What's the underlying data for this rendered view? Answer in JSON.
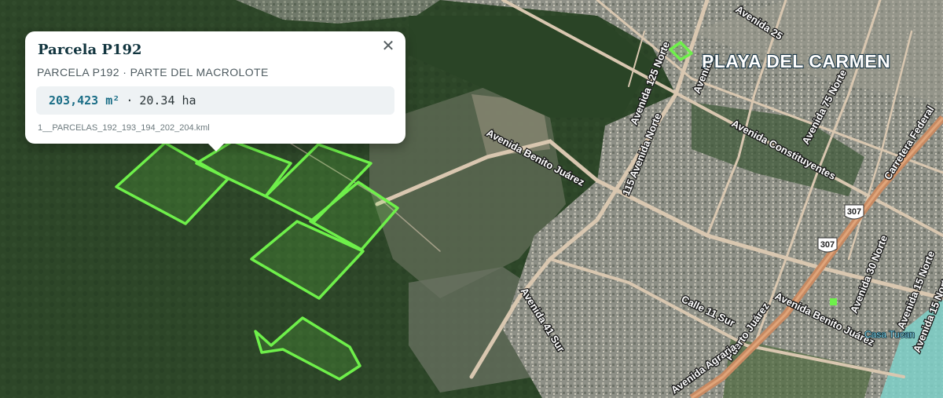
{
  "map": {
    "city_label": "PLAYA DEL CARMEN",
    "poi_label": "Casa Tucan",
    "highway_shields": [
      "307",
      "307"
    ],
    "road_labels": {
      "av_25": "Avenida 25",
      "av_norte": "Avenida",
      "av_125_norte": "Avenida 125 Norte",
      "av_115_norte": "115 Avenida Norte",
      "av_75_norte": "Avenida 75 Norte",
      "av_constituyentes": "Avenida Constituyentes",
      "av_benito_juarez_w": "Avenida Benito Juárez",
      "av_benito_juarez_e": "Avenida Benito Juárez",
      "av_41_sur": "Avenida 41 Sur",
      "calle_11_sur": "Calle 11 Sur",
      "av_puerto_juarez": "Puerto Juárez",
      "av_agraria": "Avenida Agraria",
      "av_30_norte": "Avenida 30 Norte",
      "av_15_norte": "Avenida 15 Norte",
      "av_15_norte_b": "Avenida 15 Norte",
      "carretera": "Carretera Federal"
    },
    "colors": {
      "parcel_stroke": "#6ef04a",
      "parcel_fill": "rgba(110,240,74,0.18)",
      "jungle": "#2f4a2b",
      "urban": "#8a8c84"
    }
  },
  "popup": {
    "title": "Parcela P192",
    "subtitle": "PARCELA P192 · PARTE DEL MACROLOTE",
    "area_m2": "203,423 m²",
    "separator": "·",
    "area_ha": "20.34 ha",
    "filename": "1__PARCELAS_192_193_194_202_204.kml",
    "close_symbol": "✕"
  }
}
